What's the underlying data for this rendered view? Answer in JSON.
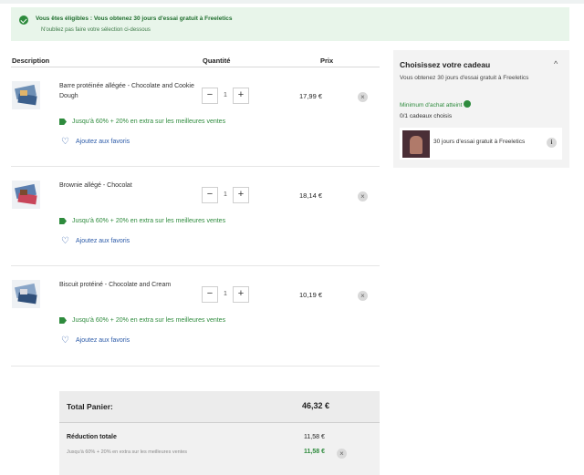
{
  "banner": {
    "title": "Vous êtes éligibles : Vous obtenez 30 jours d'essai gratuit à Freeletics",
    "subtitle": "N'oubliez pas faire votre sélection ci-dessous"
  },
  "table": {
    "headers": {
      "description": "Description",
      "quantity": "Quantité",
      "price": "Prix"
    }
  },
  "items": [
    {
      "name": "Barre protéinée allégée - Chocolate and Cookie Dough",
      "quantity": "1",
      "price": "17,99 €",
      "promo": "Jusqu'à 60% + 20% en extra sur les meilleures ventes",
      "favorite": "Ajoutez aux favoris"
    },
    {
      "name": "Brownie allégé - Chocolat",
      "quantity": "1",
      "price": "18,14 €",
      "promo": "Jusqu'à 60% + 20% en extra sur les meilleures ventes",
      "favorite": "Ajoutez aux favoris"
    },
    {
      "name": "Biscuit protéiné - Chocolate and Cream",
      "quantity": "1",
      "price": "10,19 €",
      "promo": "Jusqu'à 60% + 20% en extra sur les meilleures ventes",
      "favorite": "Ajoutez aux favoris"
    }
  ],
  "controls": {
    "minus": "−",
    "plus": "+",
    "remove": "×"
  },
  "gift": {
    "title": "Choisissez votre cadeau",
    "description": "Vous obtenez 30 jours d'essai gratuit à Freeletics",
    "minimum": "Minimum d'achat atteint",
    "count": "0/1 cadeaux choisis",
    "item": "30 jours d'essai gratuit à Freeletics",
    "info": "i",
    "chevron": "^"
  },
  "summary": {
    "total_label": "Total Panier:",
    "total_amount": "46,32 €",
    "reduction_label": "Réduction totale",
    "reduction_amount": "11,58 €",
    "promo_line": "Jusqu'à 60% + 20% en extra sur les meilleures ventes",
    "promo_amount": "11,58 €"
  },
  "colors": {
    "accent_green": "#2e8b3d",
    "link_blue": "#2b5aa8",
    "banner_bg": "#e8f5ea"
  }
}
